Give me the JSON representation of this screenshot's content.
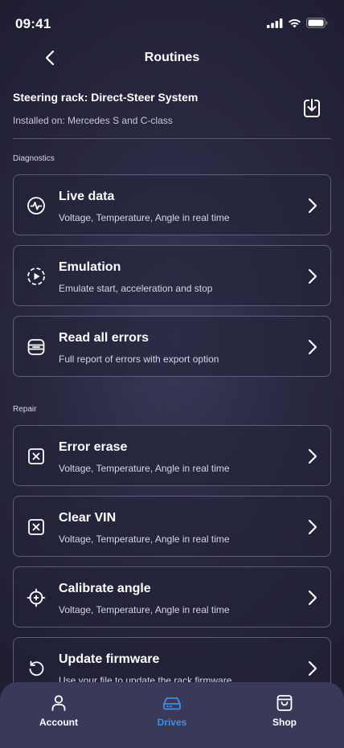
{
  "status_bar": {
    "time": "09:41"
  },
  "header": {
    "title": "Routines"
  },
  "rack": {
    "title": "Steering rack: Direct-Steer System",
    "installed": "Installed on: Mercedes S and C-class"
  },
  "sections": {
    "diagnostics": "Diagnostics",
    "repair": "Repair"
  },
  "diagnostics_items": [
    {
      "title": "Live data",
      "desc": "Voltage, Temperature, Angle in real time",
      "icon": "pulse-icon"
    },
    {
      "title": "Emulation",
      "desc": "Emulate start, acceleration and stop",
      "icon": "play-circle-icon"
    },
    {
      "title": "Read all errors",
      "desc": "Full report of errors with export option",
      "icon": "list-icon"
    }
  ],
  "repair_items": [
    {
      "title": "Error erase",
      "desc": "Voltage, Temperature, Angle in real time",
      "icon": "x-box-icon"
    },
    {
      "title": "Clear VIN",
      "desc": "Voltage, Temperature, Angle in real time",
      "icon": "x-box-icon"
    },
    {
      "title": "Calibrate angle",
      "desc": "Voltage, Temperature, Angle in real time",
      "icon": "crosshair-icon"
    },
    {
      "title": "Update firmware",
      "desc": "Use your file to update the rack firmware",
      "icon": "refresh-icon"
    }
  ],
  "tabs": [
    {
      "label": "Account",
      "icon": "user-icon",
      "active": false
    },
    {
      "label": "Drives",
      "icon": "drive-icon",
      "active": true
    },
    {
      "label": "Shop",
      "icon": "shopping-bag-icon",
      "active": false
    }
  ],
  "colors": {
    "background": "#28273f",
    "card_border": "#5f5d7a",
    "tab_bar": "#3b3959",
    "active_tab": "#3b8fe8"
  }
}
